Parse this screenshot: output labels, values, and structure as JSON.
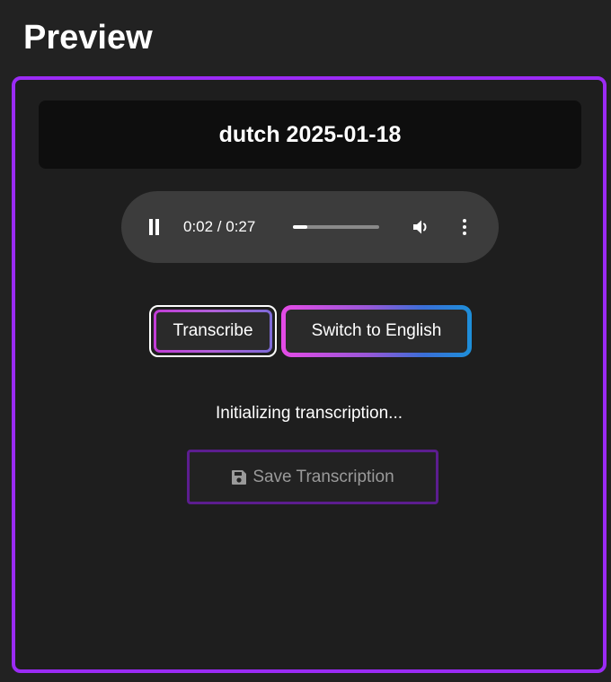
{
  "header": {
    "title": "Preview"
  },
  "preview": {
    "file_title": "dutch 2025-01-18",
    "audio": {
      "state": "playing",
      "time": "0:02 / 0:27",
      "progress": 0.074,
      "icons": {
        "play_pause": "pause-icon",
        "volume": "volume-icon",
        "more": "more-options-icon"
      }
    },
    "buttons": {
      "transcribe_label": "Transcribe",
      "switch_language_label": "Switch to English"
    },
    "status_text": "Initializing transcription...",
    "save_button": {
      "label": "Save Transcription",
      "icon": "floppy-disk-icon",
      "disabled": true
    }
  },
  "colors": {
    "background": "#222222",
    "panel_border": "#9b2bf5",
    "title_bar": "#0e0e0e",
    "player": "#3c3c3c",
    "save_border": "#5c1d8f",
    "disabled_text": "#9a9a9a"
  }
}
